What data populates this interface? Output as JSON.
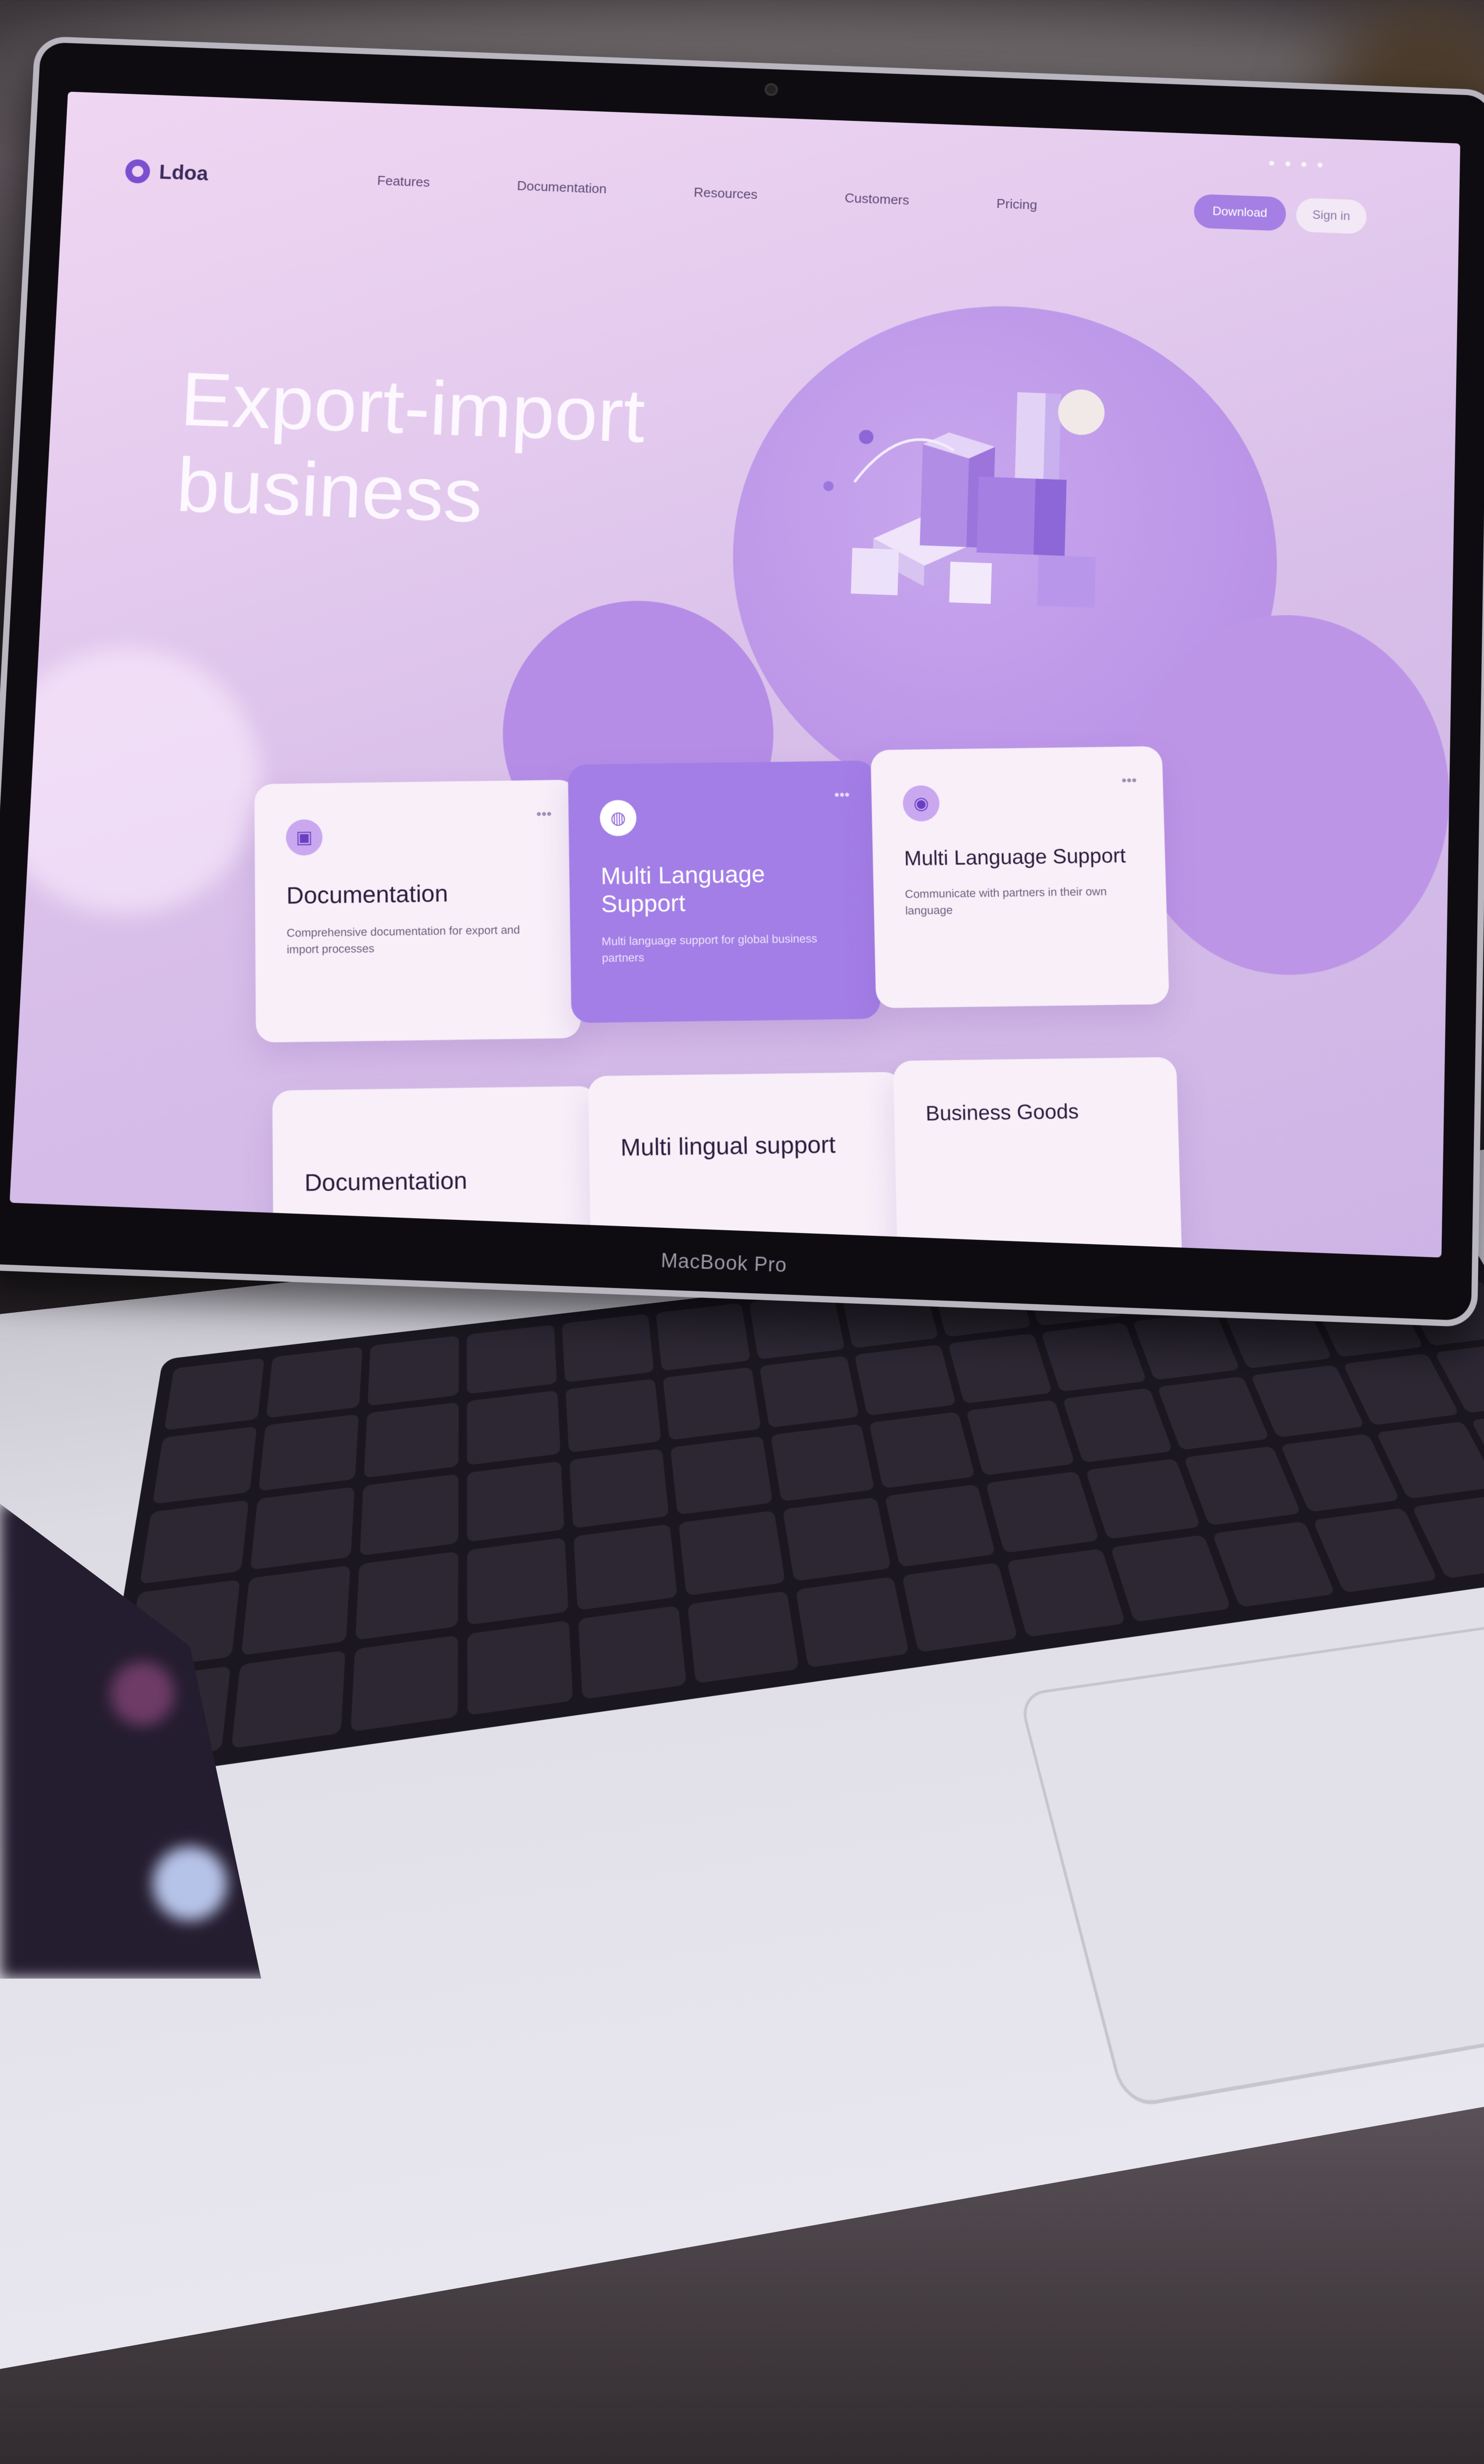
{
  "site": {
    "logo_text": "Ldoa",
    "nav": [
      "Features",
      "Documentation",
      "Resources",
      "Customers",
      "Pricing"
    ],
    "primary_button": "Download",
    "secondary_button": "Sign in"
  },
  "hero": {
    "title_line1": "Export-import",
    "title_line2": "business"
  },
  "cards": [
    {
      "title": "Documentation",
      "desc": "Comprehensive documentation for export and import processes",
      "icon": "document-icon"
    },
    {
      "title": "Multi Language Support",
      "desc": "Multi language support for global business partners",
      "icon": "globe-icon"
    },
    {
      "title": "Multi Language Support",
      "desc": "Communicate with partners in their own language",
      "icon": "language-icon"
    }
  ],
  "cards_row2": [
    {
      "title": "Documentation"
    },
    {
      "title": "Multi lingual support"
    },
    {
      "title": "Business Goods"
    }
  ],
  "bezel_brand": "MacBook Pro",
  "colors": {
    "accent": "#a37ee6",
    "bg": "#e6cdef"
  }
}
